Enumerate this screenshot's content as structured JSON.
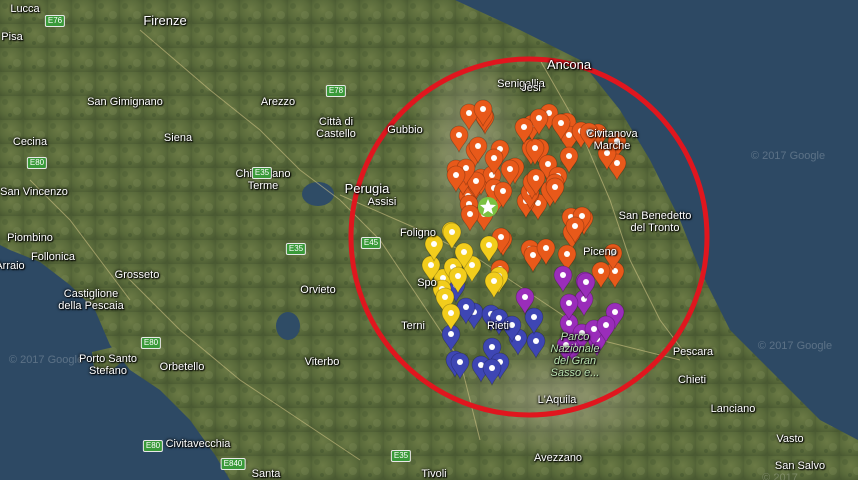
{
  "map": {
    "colors": {
      "sea": "#2d4964",
      "land": "#5e6e3e",
      "highlight_circle": "#e0161e",
      "marker_orange": "#e8591a",
      "marker_yellow": "#f2cd1c",
      "marker_blue": "#3e46b4",
      "marker_purple": "#9a2dba",
      "epicenter_star": "#7bc142",
      "road_badge": "#3a9a3a"
    },
    "epicenter_icon": "star-icon",
    "place_labels": [
      {
        "name": "Lucca"
      },
      {
        "name": "Pisa"
      },
      {
        "name": "Firenze"
      },
      {
        "name": "San Gimignano"
      },
      {
        "name": "Arezzo"
      },
      {
        "name": "Siena"
      },
      {
        "name": "Cecina"
      },
      {
        "name": "San Vincenzo"
      },
      {
        "name": "Piombino"
      },
      {
        "name": "Follonica"
      },
      {
        "name": "Grosseto"
      },
      {
        "name": "Castiglione\ndella Pescaia"
      },
      {
        "name": "Porto Santo\nStefano"
      },
      {
        "name": "Orbetello"
      },
      {
        "name": "Civitavecchia"
      },
      {
        "name": "Santa"
      },
      {
        "name": "Città di\nCastello"
      },
      {
        "name": "Gubbio"
      },
      {
        "name": "Perugia"
      },
      {
        "name": "Assisi"
      },
      {
        "name": "Chianciano\nTerme"
      },
      {
        "name": "Foligno"
      },
      {
        "name": "Orvieto"
      },
      {
        "name": "Terni"
      },
      {
        "name": "Viterbo"
      },
      {
        "name": "Senigallia"
      },
      {
        "name": "Ancona"
      },
      {
        "name": "Jesi"
      },
      {
        "name": "Civitanova\nMarche"
      },
      {
        "name": "San Benedetto\ndel Tronto"
      },
      {
        "name": "Pescara"
      },
      {
        "name": "Chieti"
      },
      {
        "name": "L'Aquila"
      },
      {
        "name": "Lanciano"
      },
      {
        "name": "Vasto"
      },
      {
        "name": "San Salvo"
      },
      {
        "name": "Avezzano"
      },
      {
        "name": "Tivoli"
      },
      {
        "name": "Spo"
      },
      {
        "name": "Rieti"
      },
      {
        "name": "Piceno"
      },
      {
        "name": "Arraio"
      }
    ],
    "park_label": "Parco\nNazionale\ndel Gran\nSasso e...",
    "road_labels": [
      "E76",
      "E35",
      "E78",
      "E35",
      "E45",
      "E80",
      "E80",
      "E80",
      "E840",
      "E35"
    ],
    "watermarks": [
      "© 2017 Google",
      "© 2017 Google",
      "© 2017 Google",
      "© 2017"
    ],
    "markers": {
      "orange": 70,
      "yellow": 15,
      "blue": 16,
      "purple": 14
    }
  }
}
